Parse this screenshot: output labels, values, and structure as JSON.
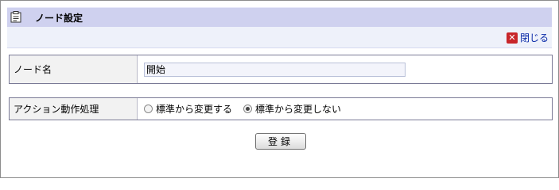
{
  "panel": {
    "title": "ノード設定",
    "title_icon": "document-icon",
    "close_label": "閉じる",
    "close_icon": "close-icon"
  },
  "node_name": {
    "label": "ノード名",
    "value": "開始"
  },
  "action": {
    "label": "アクション動作処理",
    "options": [
      {
        "label": "標準から変更する",
        "checked": false
      },
      {
        "label": "標準から変更しない",
        "checked": true
      }
    ]
  },
  "submit": {
    "label": "登録"
  },
  "colors": {
    "title_bar": "#cfd1ef",
    "toolbar": "#eef1fa",
    "close_icon": "#c8262a",
    "link": "#0a2aa8"
  }
}
